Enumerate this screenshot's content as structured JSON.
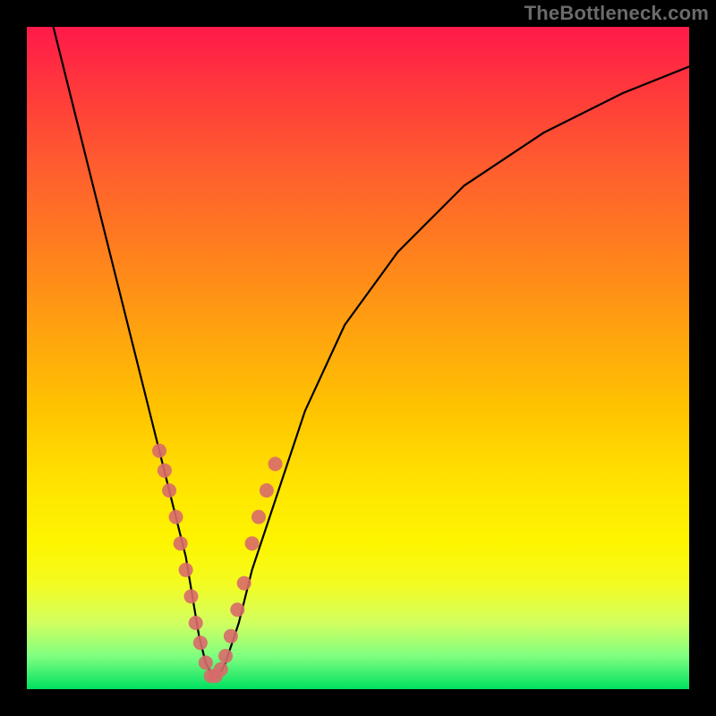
{
  "watermark": "TheBottleneck.com",
  "chart_data": {
    "type": "line",
    "title": "",
    "xlabel": "",
    "ylabel": "",
    "xlim": [
      0,
      100
    ],
    "ylim": [
      0,
      100
    ],
    "grid": false,
    "legend": false,
    "series": [
      {
        "name": "bottleneck-curve",
        "x": [
          4,
          6,
          8,
          10,
          12,
          14,
          16,
          18,
          20,
          22,
          24,
          25,
          26,
          27,
          28,
          29,
          30,
          32,
          34,
          38,
          42,
          48,
          56,
          66,
          78,
          90,
          100
        ],
        "y": [
          100,
          92,
          84,
          76,
          68,
          60,
          52,
          44,
          36,
          28,
          20,
          14,
          8,
          4,
          2,
          2,
          4,
          10,
          18,
          30,
          42,
          55,
          66,
          76,
          84,
          90,
          94
        ]
      }
    ],
    "markers": {
      "name": "highlight-dots",
      "color": "#d86a6a",
      "points": [
        {
          "x": 20.0,
          "y": 36
        },
        {
          "x": 20.8,
          "y": 33
        },
        {
          "x": 21.5,
          "y": 30
        },
        {
          "x": 22.5,
          "y": 26
        },
        {
          "x": 23.2,
          "y": 22
        },
        {
          "x": 24.0,
          "y": 18
        },
        {
          "x": 24.8,
          "y": 14
        },
        {
          "x": 25.5,
          "y": 10
        },
        {
          "x": 26.2,
          "y": 7
        },
        {
          "x": 27.0,
          "y": 4
        },
        {
          "x": 27.8,
          "y": 2
        },
        {
          "x": 28.5,
          "y": 2
        },
        {
          "x": 29.3,
          "y": 3
        },
        {
          "x": 30.0,
          "y": 5
        },
        {
          "x": 30.8,
          "y": 8
        },
        {
          "x": 31.8,
          "y": 12
        },
        {
          "x": 32.8,
          "y": 16
        },
        {
          "x": 34.0,
          "y": 22
        },
        {
          "x": 35.0,
          "y": 26
        },
        {
          "x": 36.2,
          "y": 30
        },
        {
          "x": 37.5,
          "y": 34
        }
      ]
    },
    "background_gradient": {
      "top": "#ff1a4a",
      "bottom": "#00e060"
    }
  }
}
